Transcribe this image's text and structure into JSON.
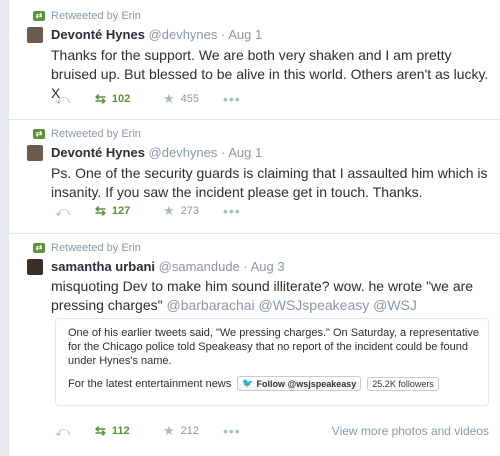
{
  "tweets": [
    {
      "retweeted_by": "Retweeted by Erin",
      "fullname": "Devonté Hynes",
      "handle": "@devhynes",
      "time": "Aug 1",
      "text": "Thanks for the support. We are both very shaken and I am pretty bruised up. But blessed to be alive in this world. Others aren't as lucky. X",
      "retweets": "102",
      "favorites": "455"
    },
    {
      "retweeted_by": "Retweeted by Erin",
      "fullname": "Devonté Hynes",
      "handle": "@devhynes",
      "time": "Aug 1",
      "text": "Ps. One of the security guards is claiming that I assaulted him which is insanity. If you saw the incident please get in touch. Thanks.",
      "retweets": "127",
      "favorites": "273"
    },
    {
      "retweeted_by": "Retweeted by Erin",
      "fullname": "samantha urbani",
      "handle": "@samandude",
      "time": "Aug 3",
      "text_start": "misquoting Dev to make him sound illiterate? wow. he wrote \"we are pressing charges\" ",
      "mentions": [
        "@barbarachai",
        "@WSJspeakeasy",
        "@WSJ"
      ],
      "retweets": "112",
      "favorites": "212",
      "view_more": "View more photos and videos",
      "card": {
        "body": "One of his earlier tweets said, \"We pressing charges.\" On Saturday, a representative for the Chicago police told Speakeasy that no report of the incident could be found under Hynes's name.",
        "footer_text": "For the latest entertainment news",
        "follow_label": "Follow @wsjspeakeasy",
        "followers": "25.2K followers"
      }
    }
  ],
  "separator": " · ",
  "icons": {
    "retweet": "retweet-icon",
    "reply": "reply-icon",
    "favorite": "star-icon",
    "more": "more-icon",
    "bird": "twitter-bird-icon"
  },
  "colors": {
    "retweet_green": "#5c913b",
    "muted": "#8899a6",
    "text": "#292f33",
    "border": "#e1e8ed"
  }
}
